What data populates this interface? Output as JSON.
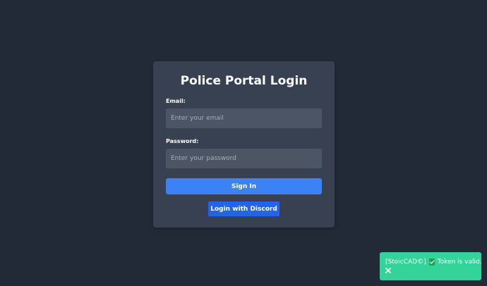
{
  "login": {
    "title": "Police Portal Login",
    "email_label": "Email:",
    "email_placeholder": "Enter your email",
    "email_value": "",
    "password_label": "Password:",
    "password_placeholder": "Enter your password",
    "password_value": "",
    "signin_label": "Sign In",
    "discord_label": "Login with Discord"
  },
  "toast": {
    "source": "[StoicCAD©]",
    "message": "Token is valid.",
    "check_icon": "check-icon",
    "close_icon": "close-icon"
  },
  "colors": {
    "background": "#222a38",
    "card": "#384152",
    "input": "#4b5563",
    "primary": "#3b82f6",
    "discord": "#2563eb",
    "toast": "#34d399"
  }
}
